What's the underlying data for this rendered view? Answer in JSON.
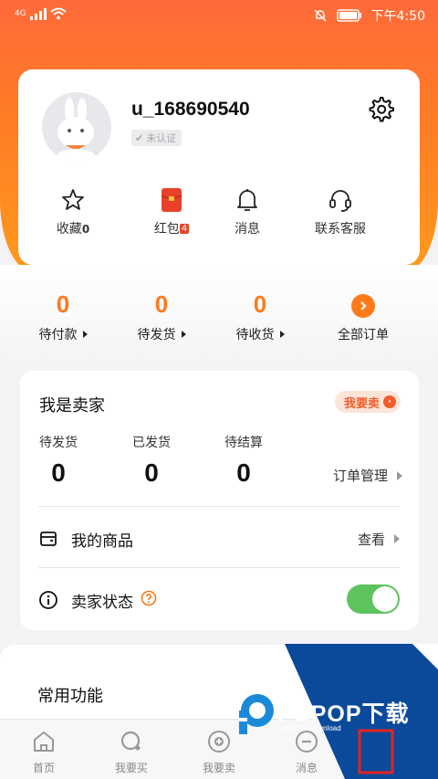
{
  "status_bar": {
    "signal": "4G",
    "time": "下午4:50"
  },
  "profile": {
    "username": "u_168690540",
    "verify_label": "未认证",
    "quick_links": [
      {
        "label": "收藏",
        "count": "0",
        "icon": "star-icon"
      },
      {
        "label": "红包",
        "count": "4",
        "icon": "red-envelope-icon"
      },
      {
        "label": "消息",
        "icon": "bell-icon"
      },
      {
        "label": "联系客服",
        "icon": "headset-icon"
      }
    ]
  },
  "orders": {
    "items": [
      {
        "label": "待付款",
        "count": "0"
      },
      {
        "label": "待发货",
        "count": "0"
      },
      {
        "label": "待收货",
        "count": "0"
      }
    ],
    "all_label": "全部订单"
  },
  "seller": {
    "title": "我是卖家",
    "sell_button": "我要卖",
    "stats": [
      {
        "label": "待发货",
        "value": "0"
      },
      {
        "label": "已发货",
        "value": "0"
      },
      {
        "label": "待结算",
        "value": "0"
      }
    ],
    "order_mgmt": "订单管理",
    "my_goods": "我的商品",
    "view_label": "查看",
    "status_label": "卖家状态",
    "status_on": true
  },
  "common": {
    "title": "常用功能"
  },
  "tabs": [
    {
      "label": "首页",
      "icon": "home-icon"
    },
    {
      "label": "我要买",
      "icon": "search-buy-icon"
    },
    {
      "label": "我要卖",
      "icon": "plus-circle-icon"
    },
    {
      "label": "消息",
      "icon": "message-icon"
    }
  ],
  "watermark": {
    "brand": "PCPOP下载",
    "sub": "PCPOP Download"
  },
  "colors": {
    "accent": "#ff7a1a",
    "toggle_on": "#5dc35e",
    "red_badge": "#e8412a"
  }
}
